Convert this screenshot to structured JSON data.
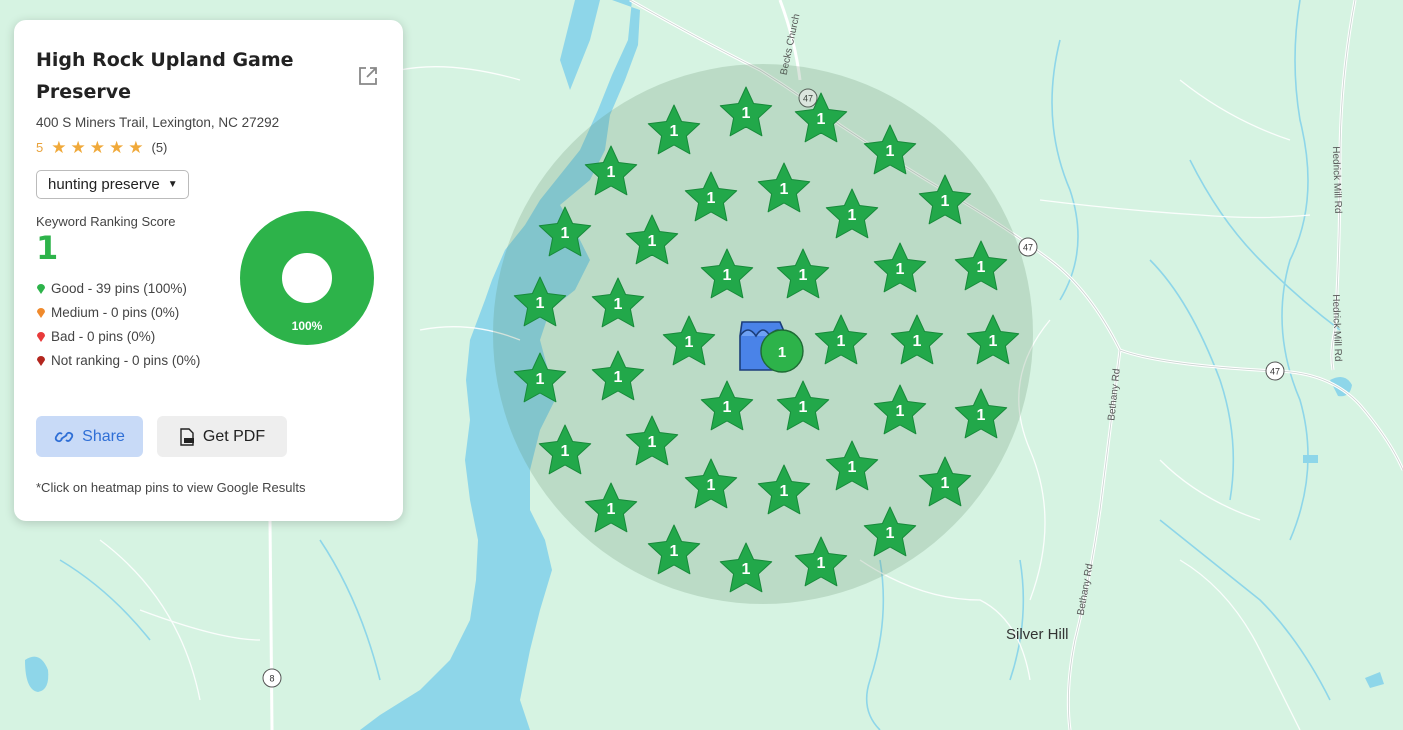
{
  "business": {
    "name": "High Rock Upland Game Preserve",
    "address": "400 S Miners Trail, Lexington, NC 27292",
    "rating": "5",
    "review_count": "(5)",
    "stars": 5
  },
  "keyword": {
    "selected": "hunting preserve"
  },
  "score": {
    "label": "Keyword Ranking Score",
    "value": "1"
  },
  "legend": [
    {
      "key": "good",
      "label": "Good",
      "detail": " - 39 pins (100%)",
      "color": "#2db34a"
    },
    {
      "key": "medium",
      "label": "Medium",
      "detail": " - 0 pins (0%)",
      "color": "#f08a2c"
    },
    {
      "key": "bad",
      "label": "Bad",
      "detail": " - 0 pins (0%)",
      "color": "#e83b3b"
    },
    {
      "key": "not-ranking",
      "label": "Not ranking",
      "detail": " - 0 pins (0%)",
      "color": "#b3261e"
    }
  ],
  "donut": {
    "good_fraction": 1.0,
    "label": "100%",
    "color": "#2db34a"
  },
  "actions": {
    "share": "Share",
    "pdf": "Get PDF"
  },
  "footnote": "*Click on heatmap pins to view Google Results",
  "map": {
    "place": "Silver Hill",
    "roads": [
      "Becks Church",
      "Bethany Rd",
      "Bethany Rd",
      "Hedrick Mill Rd",
      "Hedrick Mill Rd"
    ],
    "route_shields": [
      "47",
      "47",
      "47",
      "8"
    ],
    "center_rank": "1",
    "pin_rank": "1",
    "pin_color": "#22a84a",
    "pin_count": 39
  }
}
